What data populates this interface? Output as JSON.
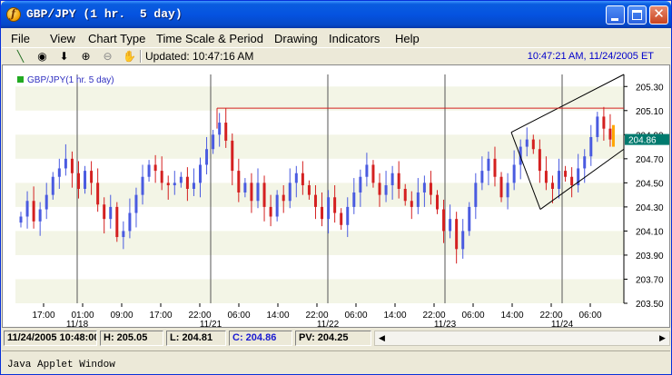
{
  "window": {
    "title": "GBP/JPY (1 hr.  5 day)"
  },
  "menu": [
    {
      "label": "File",
      "name": "menu-file"
    },
    {
      "label": "View",
      "name": "menu-view"
    },
    {
      "label": "Chart Type",
      "name": "menu-chart-type"
    },
    {
      "label": "Time Scale & Period",
      "name": "menu-time-scale"
    },
    {
      "label": "Drawing",
      "name": "menu-drawing"
    },
    {
      "label": "Indicators",
      "name": "menu-indicators"
    },
    {
      "label": "Help",
      "name": "menu-help"
    }
  ],
  "toolbar": {
    "tools": [
      {
        "name": "line-tool-icon",
        "glyph": "╲"
      },
      {
        "name": "crosshair-tool-icon",
        "glyph": "◉"
      },
      {
        "name": "down-arrow-tool-icon",
        "glyph": "⬇"
      },
      {
        "name": "zoom-in-icon",
        "glyph": "⊕"
      },
      {
        "name": "zoom-out-icon",
        "glyph": "⊖"
      },
      {
        "name": "pan-hand-icon",
        "glyph": "✋"
      }
    ],
    "updated": "Updated: 10:47:16 AM",
    "clock": "10:47:21 AM, 11/24/2005 ET"
  },
  "chart_data": {
    "type": "candlestick",
    "legend": "GBP/JPY(1 hr.  5 day)",
    "legend_placement": "top-left",
    "ylim": [
      203.5,
      205.4
    ],
    "yticks": [
      "205.30",
      "205.10",
      "204.90",
      "204.70",
      "204.50",
      "204.30",
      "204.10",
      "203.90",
      "203.70",
      "203.50"
    ],
    "ytick_values": [
      205.3,
      205.1,
      204.9,
      204.7,
      204.5,
      204.3,
      204.1,
      203.9,
      203.7,
      203.5
    ],
    "current_price": "204.86",
    "xticks": [
      "17:00",
      "01:00",
      "09:00",
      "17:00",
      "22:00",
      "06:00",
      "14:00",
      "22:00",
      "06:00",
      "14:00",
      "22:00",
      "06:00",
      "14:00",
      "22:00",
      "06:00"
    ],
    "date_labels": [
      "11/18",
      "11/21",
      "11/22",
      "11/23",
      "11/24"
    ],
    "colors": {
      "up": "#4a5be0",
      "down": "#d42020",
      "grid_band": "#f3f5e6",
      "current_bg": "#007a6e"
    },
    "series_close": [
      204.22,
      204.35,
      204.18,
      204.28,
      204.4,
      204.55,
      204.62,
      204.7,
      204.58,
      204.45,
      204.6,
      204.5,
      204.32,
      204.2,
      204.3,
      204.05,
      204.1,
      204.25,
      204.4,
      204.55,
      204.65,
      204.6,
      204.5,
      204.48,
      204.5,
      204.55,
      204.45,
      204.5,
      204.65,
      204.78,
      204.9,
      205.0,
      204.85,
      204.6,
      204.42,
      204.5,
      204.35,
      204.5,
      204.3,
      204.22,
      204.4,
      204.35,
      204.5,
      204.58,
      204.48,
      204.4,
      204.3,
      204.2,
      204.38,
      204.25,
      204.15,
      204.3,
      204.42,
      204.55,
      204.65,
      204.5,
      204.4,
      204.48,
      204.58,
      204.45,
      204.35,
      204.3,
      204.42,
      204.5,
      204.4,
      204.28,
      204.1,
      204.2,
      203.95,
      204.1,
      204.3,
      204.5,
      204.6,
      204.7,
      204.55,
      204.38,
      204.5,
      204.65,
      204.8,
      204.86,
      204.78,
      204.6,
      204.5,
      204.45,
      204.6,
      204.55,
      204.48,
      204.62,
      204.72,
      204.88,
      205.05,
      204.95,
      204.86
    ]
  },
  "status": {
    "datetime": "11/24/2005 10:48:00",
    "high": "H: 205.05",
    "low": "L: 204.81",
    "close": "C: 204.86",
    "pv": "PV: 204.25"
  },
  "applet": {
    "label": "Java Applet Window"
  }
}
